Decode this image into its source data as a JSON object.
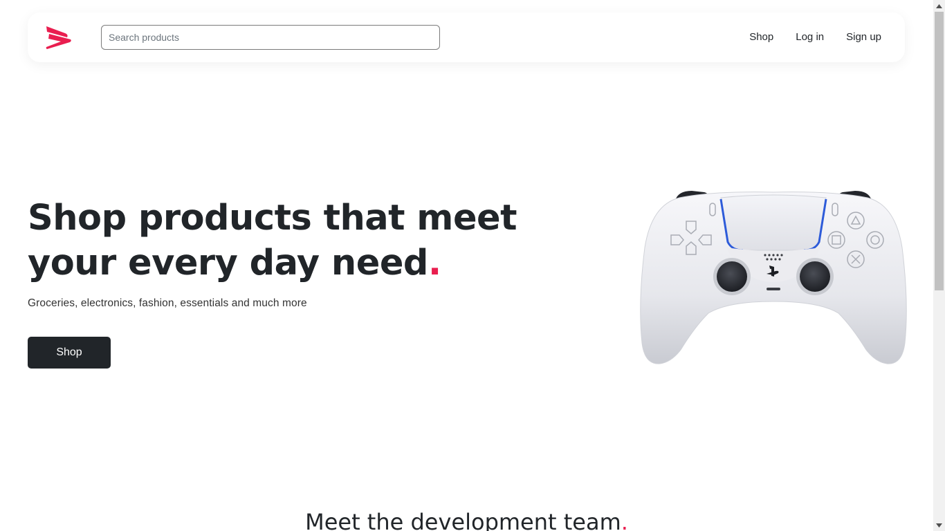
{
  "navbar": {
    "logo_icon": "brand-logo-icon",
    "search_placeholder": "Search products",
    "links": [
      {
        "label": "Shop"
      },
      {
        "label": "Log in"
      },
      {
        "label": "Sign up"
      }
    ]
  },
  "hero": {
    "title": "Shop products that meet your every day need",
    "title_dot": ".",
    "subtitle": "Groceries, electronics, fashion, essentials and much more",
    "button_label": "Shop",
    "image_icon": "game-controller-image"
  },
  "team_section": {
    "heading": "Meet the development team",
    "heading_dot": "."
  },
  "colors": {
    "accent": "#e91e4f",
    "dark": "#212529",
    "background": "#ffffff"
  }
}
